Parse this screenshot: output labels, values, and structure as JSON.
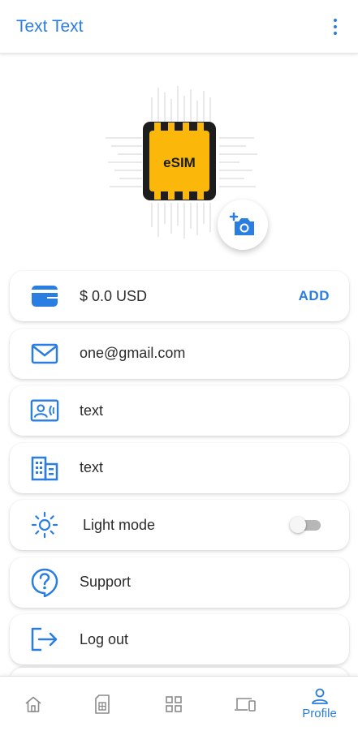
{
  "appbar": {
    "title": "Text Text",
    "menu_icon": "more-vertical-icon"
  },
  "profile": {
    "image": "esim-chip",
    "chip_label": "eSIM",
    "camera_icon": "add-photo-icon"
  },
  "items": [
    {
      "icon": "wallet-icon",
      "label": "$ 0.0 USD",
      "action": "ADD"
    },
    {
      "icon": "mail-icon",
      "label": "one@gmail.com"
    },
    {
      "icon": "contact-card-icon",
      "label": "text"
    },
    {
      "icon": "building-icon",
      "label": "text"
    },
    {
      "icon": "sun-icon",
      "label": "Light mode",
      "toggle": false
    },
    {
      "icon": "help-icon",
      "label": "Support"
    },
    {
      "icon": "logout-icon",
      "label": "Log out"
    }
  ],
  "nav": [
    {
      "icon": "home-icon"
    },
    {
      "icon": "sim-card-icon"
    },
    {
      "icon": "grid-icon"
    },
    {
      "icon": "devices-icon"
    },
    {
      "icon": "person-icon",
      "label": "Profile",
      "active": true
    }
  ],
  "colors": {
    "accent": "#2a7de1",
    "text": "#2b2b2b",
    "chip": "#fbb80a"
  }
}
